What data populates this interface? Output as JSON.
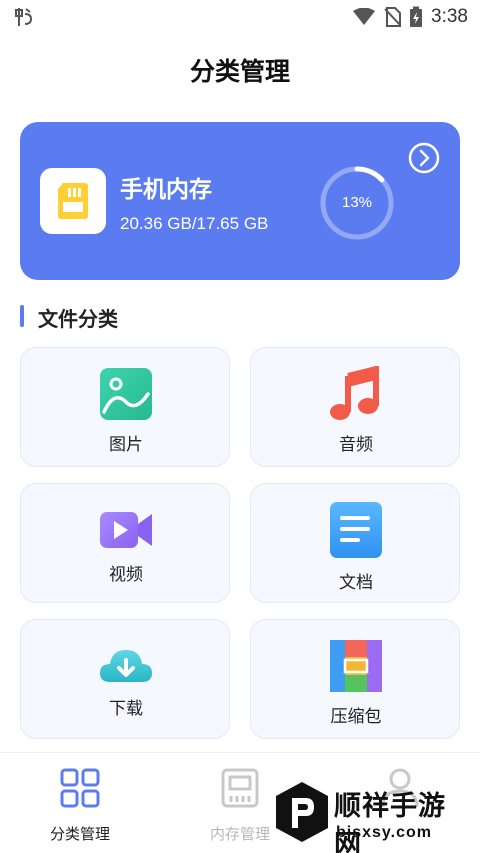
{
  "status_bar": {
    "time": "3:38",
    "icons": [
      "app-notification-icon",
      "wifi-icon",
      "no-sim-icon",
      "battery-charging-icon"
    ]
  },
  "page": {
    "title": "分类管理"
  },
  "storage": {
    "name": "手机内存",
    "size": "20.36 GB/17.65 GB",
    "percent_label": "13%",
    "percent_value": 0.13,
    "accent_color": "#5b7cf1"
  },
  "section": {
    "title": "文件分类"
  },
  "categories": [
    {
      "label": "图片",
      "icon": "image-icon"
    },
    {
      "label": "音频",
      "icon": "music-note-icon"
    },
    {
      "label": "视频",
      "icon": "video-camera-icon"
    },
    {
      "label": "文档",
      "icon": "document-icon"
    },
    {
      "label": "下载",
      "icon": "cloud-download-icon"
    },
    {
      "label": "压缩包",
      "icon": "archive-icon"
    }
  ],
  "bottom_nav": {
    "items": [
      {
        "label": "分类管理",
        "icon": "grid-icon",
        "active": true
      },
      {
        "label": "内存管理",
        "icon": "memory-chip-icon",
        "active": false
      },
      {
        "label": "",
        "icon": "user-icon",
        "active": false
      }
    ],
    "active_color": "#5b7cf1",
    "inactive_color": "#c8c8c8"
  },
  "watermark": {
    "title": "顺祥手游网",
    "url": "bjsxsy.com"
  }
}
